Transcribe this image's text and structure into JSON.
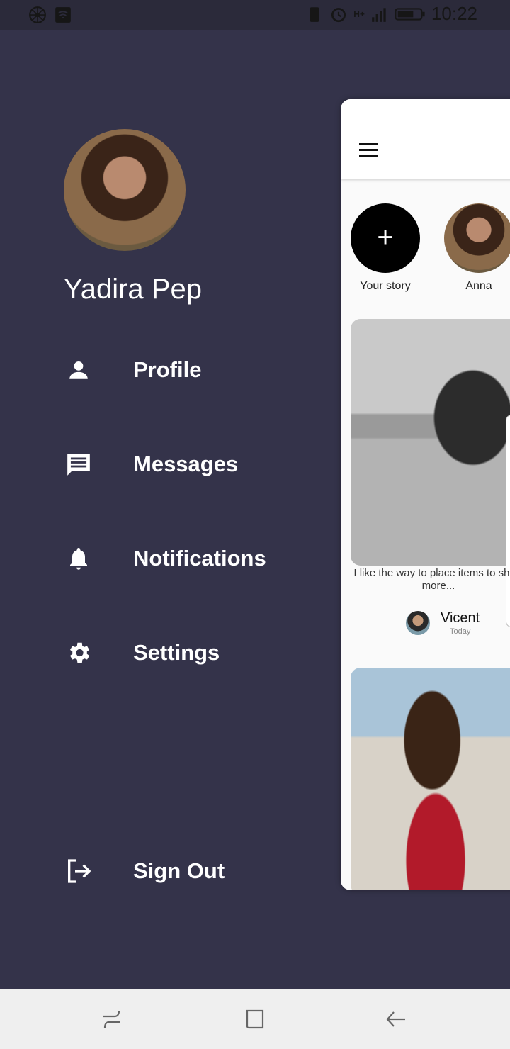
{
  "status_bar": {
    "time": "10:22",
    "network": "H+"
  },
  "drawer": {
    "user_name": "Yadira Pep",
    "items": [
      {
        "label": "Profile",
        "icon": "person-icon"
      },
      {
        "label": "Messages",
        "icon": "message-icon"
      },
      {
        "label": "Notifications",
        "icon": "bell-icon"
      },
      {
        "label": "Settings",
        "icon": "gear-icon"
      }
    ],
    "sign_out": {
      "label": "Sign Out",
      "icon": "logout-icon"
    }
  },
  "preview": {
    "stories": [
      {
        "label": "Your story",
        "symbol": "+"
      },
      {
        "label": "Anna"
      }
    ],
    "post": {
      "caption": "I like the way to place items to show more...",
      "author": "Vicent",
      "date": "Today"
    }
  },
  "colors": {
    "drawer_bg": "#34334a",
    "status_bg": "#2b2a3a",
    "text_light": "#ffffff"
  }
}
